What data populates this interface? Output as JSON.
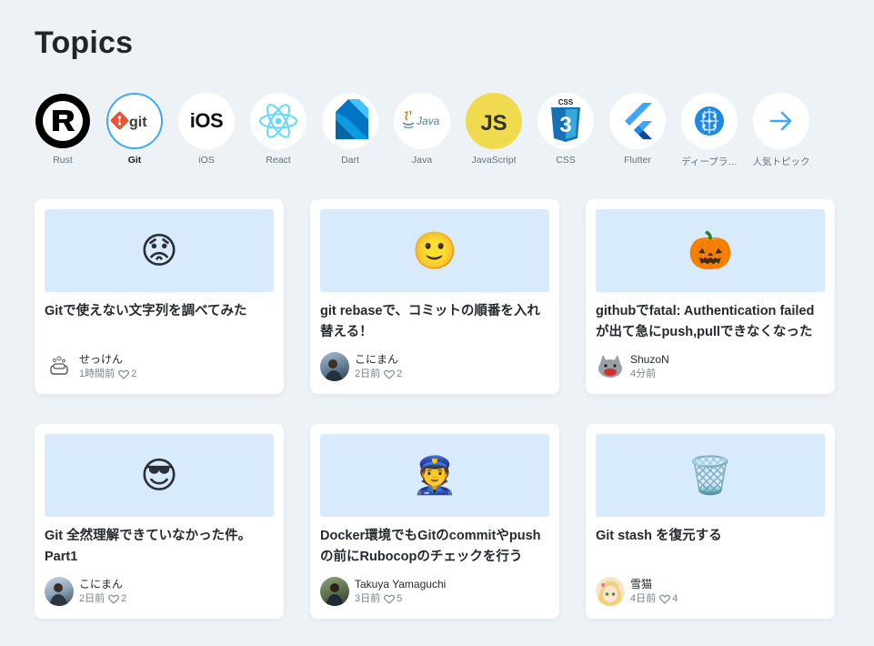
{
  "page": {
    "title": "Topics"
  },
  "topics": [
    {
      "label": "Rust",
      "icon": "rust-icon"
    },
    {
      "label": "Git",
      "icon": "git-icon",
      "selected": true
    },
    {
      "label": "iOS",
      "icon": "ios-icon"
    },
    {
      "label": "React",
      "icon": "react-icon"
    },
    {
      "label": "Dart",
      "icon": "dart-icon"
    },
    {
      "label": "Java",
      "icon": "java-icon"
    },
    {
      "label": "JavaScript",
      "icon": "javascript-icon"
    },
    {
      "label": "CSS",
      "icon": "css3-icon"
    },
    {
      "label": "Flutter",
      "icon": "flutter-icon"
    },
    {
      "label": "ディープラ…",
      "icon": "brain-icon"
    },
    {
      "label": "人気トピック",
      "icon": "arrow-right-icon"
    }
  ],
  "topic_icon_text": {
    "git": "git",
    "ios": "iOS",
    "java": "Java",
    "javascript": "JS",
    "css_top": "CSS",
    "css_num": "3"
  },
  "articles": [
    {
      "emoji": "😟",
      "title": "Gitで使えない文字列を調べてみた",
      "author": "せっけん",
      "time": "1時間前",
      "likes": "2",
      "avatar": "soap-avatar"
    },
    {
      "emoji": "🙂",
      "title": "git rebaseで、コミットの順番を入れ替える！",
      "author": "こにまん",
      "time": "2日前",
      "likes": "2",
      "avatar": "photo-avatar"
    },
    {
      "emoji": "🎃",
      "title": "githubでfatal: Authentication failedが出て急にpush,pullできなくなった",
      "author": "ShuzoN",
      "time": "4分前",
      "likes": "",
      "avatar": "cat-avatar"
    },
    {
      "emoji": "😎",
      "title": "Git 全然理解できていなかった件。Part1",
      "author": "こにまん",
      "time": "2日前",
      "likes": "2",
      "avatar": "photo-avatar"
    },
    {
      "emoji": "👮",
      "title": "Docker環境でもGitのcommitやpushの前にRubocopのチェックを行う",
      "author": "Takuya Yamaguchi",
      "time": "3日前",
      "likes": "5",
      "avatar": "photo-avatar"
    },
    {
      "emoji": "🗑️",
      "title": "Git stash を復元する",
      "author": "雪猫",
      "time": "4日前",
      "likes": "4",
      "avatar": "anime-avatar"
    }
  ],
  "colors": {
    "background": "#edf2f7",
    "accent": "#3ea8ff",
    "thumbnail": "#d8ebfd"
  }
}
